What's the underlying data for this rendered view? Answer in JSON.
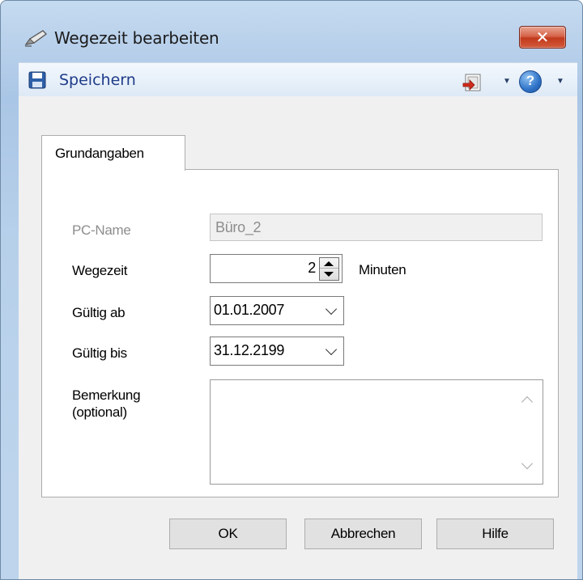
{
  "window": {
    "title": "Wegezeit bearbeiten",
    "close_label": "✕",
    "title_icon": "pen-icon"
  },
  "toolbar": {
    "save_label": "Speichern",
    "save_icon": "floppy-disk-icon",
    "exit_icon": "exit-door-icon",
    "help_icon": "help-icon",
    "help_glyph": "?",
    "dropdown_glyph": "▼"
  },
  "tabs": [
    {
      "label": "Grundangaben",
      "active": true
    }
  ],
  "form": {
    "pc_name": {
      "label": "PC-Name",
      "value": "Büro_2",
      "disabled": true
    },
    "wegezeit": {
      "label": "Wegezeit",
      "value": "2",
      "unit": "Minuten"
    },
    "gueltig_ab": {
      "label": "Gültig ab",
      "value": "01.01.2007"
    },
    "gueltig_bis": {
      "label": "Gültig bis",
      "value": "31.12.2199"
    },
    "bemerkung": {
      "label_line1": "Bemerkung",
      "label_line2": "(optional)",
      "value": ""
    }
  },
  "buttons": {
    "ok": "OK",
    "cancel": "Abbrechen",
    "help": "Hilfe"
  },
  "colors": {
    "close_button": "#c23a1d",
    "toolbar_text": "#1e3c8a",
    "disabled_text": "#8d8d8d"
  }
}
